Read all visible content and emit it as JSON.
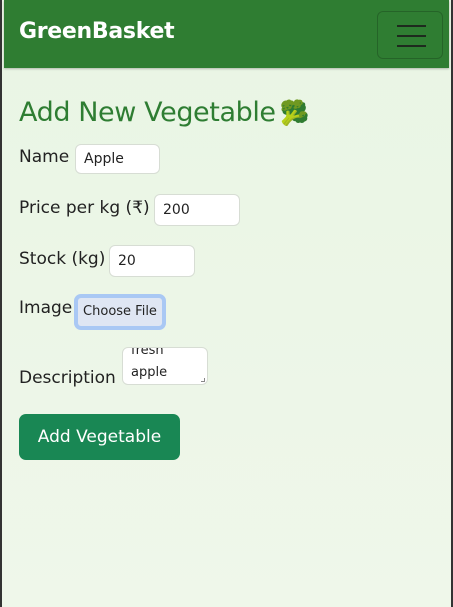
{
  "navbar": {
    "brand": "GreenBasket",
    "menu_icon": "hamburger-menu-icon"
  },
  "form": {
    "title": "Add New Vegetable",
    "title_emoji": "🥦",
    "title_icon": "broccoli-icon",
    "name": {
      "label": "Name",
      "value": "Apple"
    },
    "price": {
      "label": "Price per kg (₹)",
      "value": "200"
    },
    "stock": {
      "label": "Stock (kg)",
      "value": "20"
    },
    "image": {
      "label": "Image",
      "button_label": "Choose File"
    },
    "description": {
      "label": "Description",
      "line1": "fresh",
      "line2": "apple"
    },
    "submit_label": "Add Vegetable"
  },
  "colors": {
    "navbar": "#2f7d32",
    "title": "#2e7d32",
    "submit": "#198754",
    "background": "#eaf5e6"
  }
}
